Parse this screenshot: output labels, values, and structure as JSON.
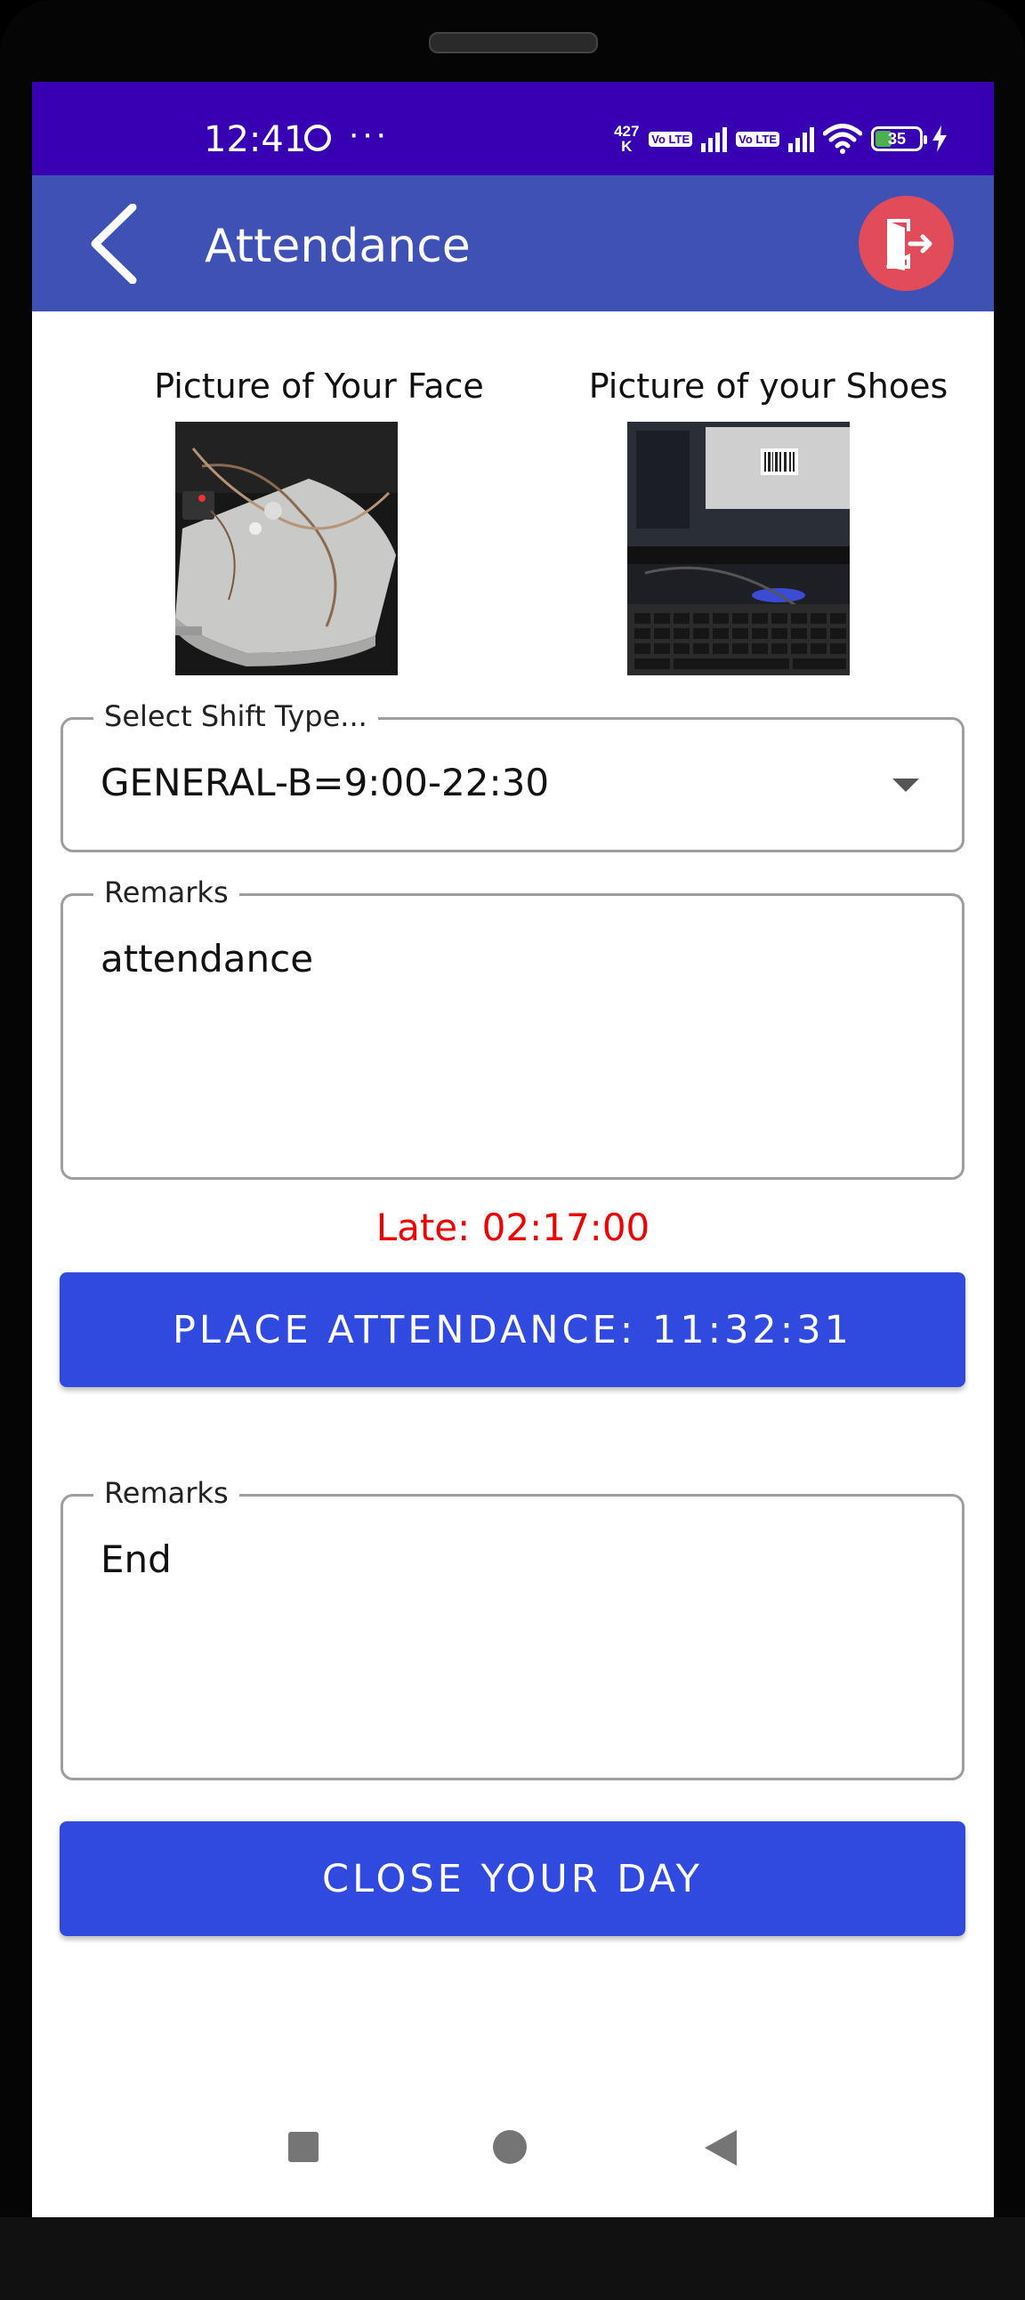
{
  "status_bar": {
    "time": "12:41",
    "more": "···",
    "net_speed": "427",
    "net_speed_unit": "K",
    "volte1": "Vo LTE",
    "volte2": "Vo LTE",
    "battery": "35"
  },
  "app_bar": {
    "title": "Attendance"
  },
  "photos": {
    "face_label": "Picture of Your Face",
    "shoes_label": "Picture of your Shoes"
  },
  "shift_select": {
    "label": "Select Shift Type...",
    "value": "GENERAL-B=9:00-22:30"
  },
  "remarks_in": {
    "label": "Remarks",
    "value": "attendance"
  },
  "late_text": "Late: 02:17:00",
  "place_button": "PLACE ATTENDANCE: 11:32:31",
  "remarks_out": {
    "label": "Remarks",
    "value": "End"
  },
  "close_button": "CLOSE YOUR DAY",
  "colors": {
    "status_bar": "#3700b3",
    "app_bar": "#3f51b5",
    "button": "#304ae0",
    "exit_button": "#e24c5a",
    "late_text": "#ee0000"
  }
}
